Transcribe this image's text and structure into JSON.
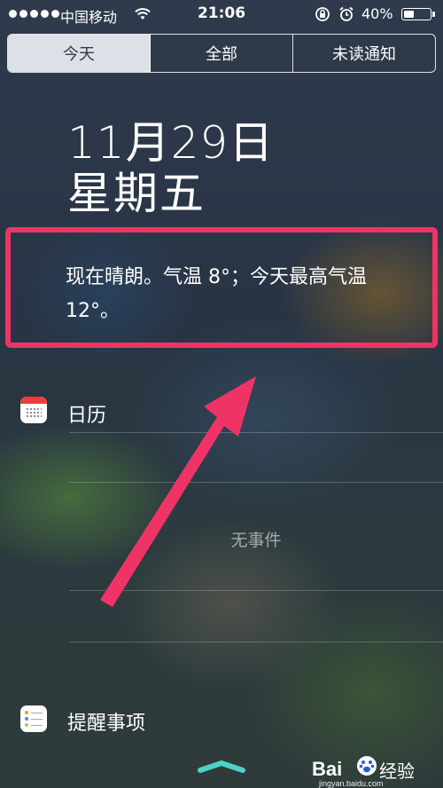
{
  "status_bar": {
    "carrier": "中国移动",
    "time": "21:06",
    "battery_percent": "40%",
    "battery_level": 0.4,
    "icons": [
      "signal-dots-icon",
      "wifi-icon",
      "orientation-lock-icon",
      "alarm-clock-icon",
      "battery-icon"
    ]
  },
  "tabs": [
    {
      "label": "今天",
      "active": true
    },
    {
      "label": "全部",
      "active": false
    },
    {
      "label": "未读通知",
      "active": false
    }
  ],
  "today": {
    "date": "11月29日",
    "weekday": "星期五",
    "weather_summary": "现在晴朗。气温 8°；今天最高气温 12°。"
  },
  "calendar": {
    "title": "日历",
    "empty_text": "无事件",
    "icon": "calendar-icon"
  },
  "reminders": {
    "title": "提醒事项",
    "icon": "reminders-icon"
  },
  "annotation": {
    "highlight_color": "#f03366"
  },
  "watermark": {
    "brand": "Bai",
    "brand_cn": "经验",
    "url": "jingyan.baidu.com"
  }
}
